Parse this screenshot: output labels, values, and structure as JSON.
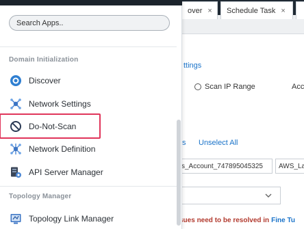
{
  "background_app": {
    "tabs": [
      {
        "label": "over",
        "close": "×"
      },
      {
        "label": "Schedule Task",
        "close": "×"
      },
      {
        "label": "",
        "close": "×"
      }
    ],
    "settings_link_fragment": "ttings",
    "scan_ip_range_label": "Scan IP Range",
    "acc_fragment": "Acc",
    "s_fragment": "s",
    "unselect_all_label": "Unselect All",
    "account_field_value": "s_Account_747895045325",
    "aws_field_value": "AWS_La",
    "banner": {
      "text": "sues need to be resolved in",
      "link": "Fine Tu"
    }
  },
  "launcher": {
    "search": {
      "placeholder": "Search Apps.."
    },
    "sections": [
      {
        "title": "Domain Initialization",
        "items": [
          {
            "label": "Discover",
            "icon": "discover-icon"
          },
          {
            "label": "Network Settings",
            "icon": "network-settings-icon"
          },
          {
            "label": "Do-Not-Scan",
            "icon": "do-not-scan-icon",
            "highlighted": true
          },
          {
            "label": "Network Definition",
            "icon": "network-definition-icon"
          },
          {
            "label": "API Server Manager",
            "icon": "api-server-manager-icon"
          }
        ]
      },
      {
        "title": "Topology Manager",
        "items": [
          {
            "label": "Topology Link Manager",
            "icon": "topology-link-manager-icon"
          }
        ]
      }
    ]
  },
  "colors": {
    "highlight": "#e0345a",
    "link": "#1a73c9",
    "dark_header": "#1b232b"
  }
}
